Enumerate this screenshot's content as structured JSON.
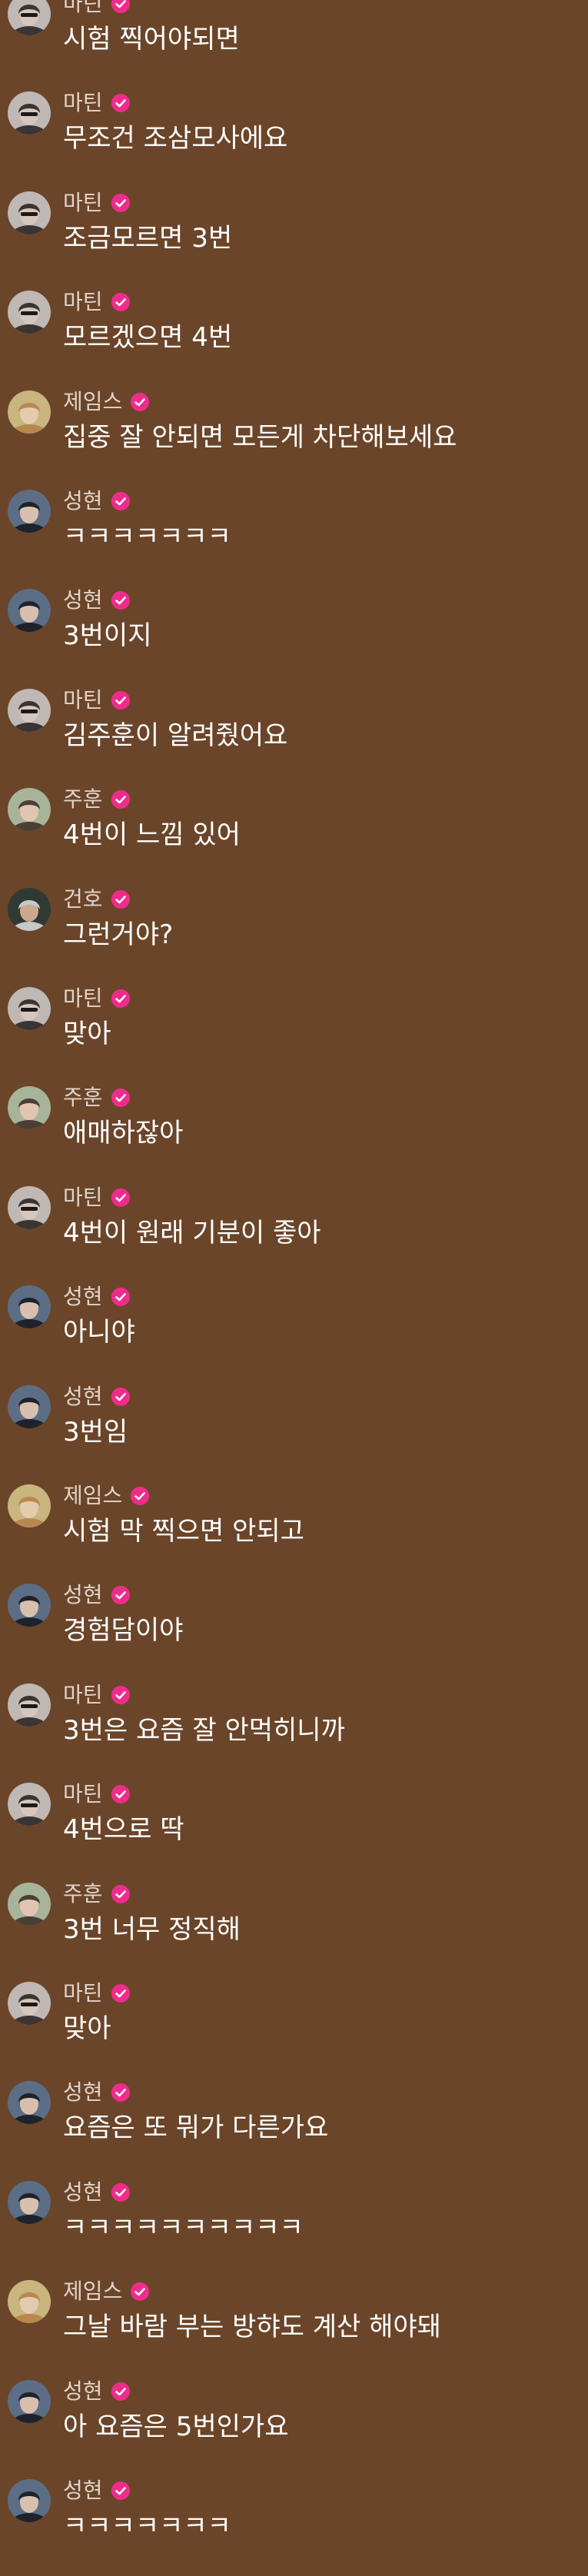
{
  "colors": {
    "background": "#6b4529",
    "name_text": "#e0d4cb",
    "message_text": "#ffffff",
    "badge": "#ef2c8c"
  },
  "avatar_styles": {
    "martin": {
      "bg": "#bfb8b4",
      "hair": "#3a3533",
      "face": "#d7c6bc",
      "glasses": true,
      "icon": "avatar-martin-icon"
    },
    "james": {
      "bg": "#c9b57e",
      "hair": "#b7894f",
      "face": "#e3cbb0",
      "glasses": false,
      "icon": "avatar-james-icon"
    },
    "sunghyun": {
      "bg": "#5b6e86",
      "hair": "#1e232b",
      "face": "#d9c0ae",
      "glasses": false,
      "icon": "avatar-sunghyun-icon"
    },
    "juhoon": {
      "bg": "#a7b49a",
      "hair": "#4a3f36",
      "face": "#e2c5b1",
      "glasses": false,
      "icon": "avatar-juhoon-icon"
    },
    "gunho": {
      "bg": "#2f3a33",
      "hair": "#c7c9c4",
      "face": "#cda88f",
      "glasses": false,
      "icon": "avatar-gunho-icon"
    }
  },
  "messages": [
    {
      "sender": "마틴",
      "avatar": "martin",
      "text": "시험 찍어야되면"
    },
    {
      "sender": "마틴",
      "avatar": "martin",
      "text": "무조건 조삼모사에요"
    },
    {
      "sender": "마틴",
      "avatar": "martin",
      "text": "조금모르면 3번"
    },
    {
      "sender": "마틴",
      "avatar": "martin",
      "text": "모르겠으면 4번"
    },
    {
      "sender": "제임스",
      "avatar": "james",
      "text": "집중 잘 안되면 모든게 차단해보세요"
    },
    {
      "sender": "성현",
      "avatar": "sunghyun",
      "text": "ㅋㅋㅋㅋㅋㅋㅋ"
    },
    {
      "sender": "성현",
      "avatar": "sunghyun",
      "text": "3번이지"
    },
    {
      "sender": "마틴",
      "avatar": "martin",
      "text": "김주훈이 알려줬어요"
    },
    {
      "sender": "주훈",
      "avatar": "juhoon",
      "text": "4번이 느낌 있어"
    },
    {
      "sender": "건호",
      "avatar": "gunho",
      "text": "그런거야?"
    },
    {
      "sender": "마틴",
      "avatar": "martin",
      "text": "맞아"
    },
    {
      "sender": "주훈",
      "avatar": "juhoon",
      "text": "애매하잖아"
    },
    {
      "sender": "마틴",
      "avatar": "martin",
      "text": "4번이 원래 기분이 좋아"
    },
    {
      "sender": "성현",
      "avatar": "sunghyun",
      "text": "아니야"
    },
    {
      "sender": "성현",
      "avatar": "sunghyun",
      "text": "3번임"
    },
    {
      "sender": "제임스",
      "avatar": "james",
      "text": "시험 막 찍으면 안되고"
    },
    {
      "sender": "성현",
      "avatar": "sunghyun",
      "text": "경험담이야"
    },
    {
      "sender": "마틴",
      "avatar": "martin",
      "text": "3번은 요즘 잘 안먹히니까"
    },
    {
      "sender": "마틴",
      "avatar": "martin",
      "text": "4번으로 딱"
    },
    {
      "sender": "주훈",
      "avatar": "juhoon",
      "text": "3번 너무 정직해"
    },
    {
      "sender": "마틴",
      "avatar": "martin",
      "text": "맞아"
    },
    {
      "sender": "성현",
      "avatar": "sunghyun",
      "text": "요즘은 또 뭐가 다른가요"
    },
    {
      "sender": "성현",
      "avatar": "sunghyun",
      "text": "ㅋㅋㅋㅋㅋㅋㅋㅋㅋㅋ"
    },
    {
      "sender": "제임스",
      "avatar": "james",
      "text": "그날 바람 부는 방햐도 계산 해야돼"
    },
    {
      "sender": "성현",
      "avatar": "sunghyun",
      "text": "아 요즘은 5번인가요"
    },
    {
      "sender": "성현",
      "avatar": "sunghyun",
      "text": "ㅋㅋㅋㅋㅋㅋㅋ"
    }
  ]
}
